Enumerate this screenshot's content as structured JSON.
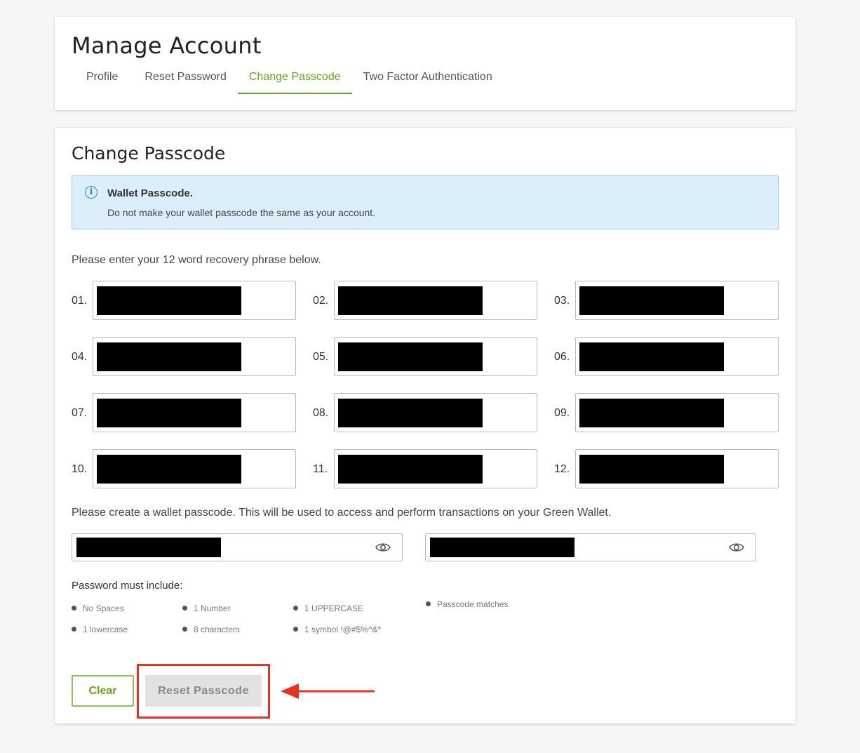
{
  "header": {
    "title": "Manage Account",
    "tabs": [
      {
        "label": "Profile"
      },
      {
        "label": "Reset Password"
      },
      {
        "label": "Change Passcode",
        "active": true
      },
      {
        "label": "Two Factor Authentication"
      }
    ]
  },
  "main": {
    "title": "Change Passcode",
    "alert": {
      "icon": "info-icon",
      "title": "Wallet Passcode.",
      "body": "Do not make your wallet passcode the same as your account."
    },
    "recovery_instruction": "Please enter your 12 word recovery phrase below.",
    "phrase_labels": [
      "01.",
      "02.",
      "03.",
      "04.",
      "05.",
      "06.",
      "07.",
      "08.",
      "09.",
      "10.",
      "11.",
      "12."
    ],
    "passcode_instruction": "Please create a wallet passcode. This will be used to access and perform transactions on your Green Wallet.",
    "requirements": {
      "title": "Password must include:",
      "items": [
        "No Spaces",
        "1 Number",
        "1 UPPERCASE",
        "1 lowercase",
        "8 characters",
        "1 symbol !@#$%^&*"
      ],
      "match": "Passcode matches"
    },
    "buttons": {
      "clear": "Clear",
      "reset": "Reset Passcode"
    }
  },
  "colors": {
    "accent": "#6aa31d",
    "annotation": "#e53323",
    "alert_bg": "#ddeefb",
    "alert_icon": "#2d7fc1"
  }
}
